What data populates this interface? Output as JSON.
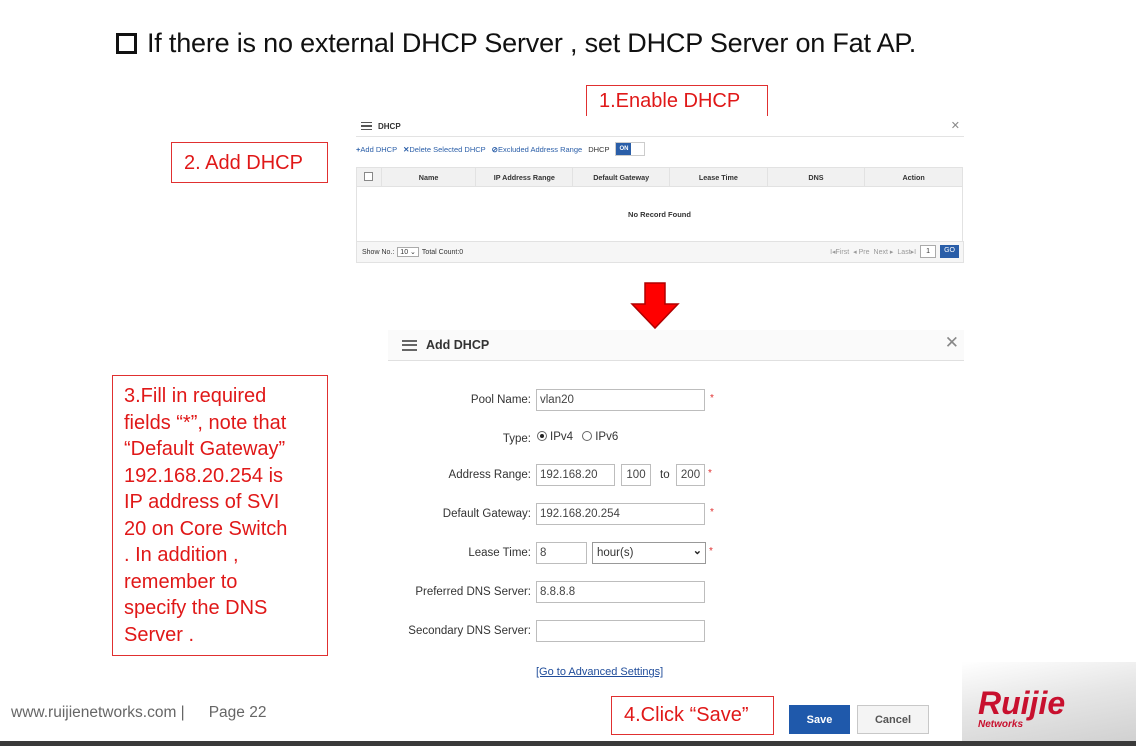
{
  "slide": {
    "title": "If there is no external DHCP Server , set DHCP Server on Fat AP.",
    "footer_url": "www.ruijienetworks.com |",
    "footer_page": "Page  22",
    "logo_text": "Ruijie",
    "logo_subtext": "Networks"
  },
  "callouts": {
    "enable_dhcp": "1.Enable DHCP",
    "add_dhcp": "2. Add DHCP",
    "click_save": "4.Click “Save”",
    "fill_fields_lines": [
      "3.Fill in required",
      "fields “*”,  note that",
      "“Default Gateway”",
      "192.168.20.254 is",
      "IP address of SVI",
      "20 on Core Switch",
      ". In addition ,",
      "remember to",
      "specify the DNS",
      "Server ."
    ]
  },
  "dhcp_window": {
    "title": "DHCP",
    "toolbar": {
      "add": "Add DHCP",
      "delete": "Delete Selected DHCP",
      "excluded": "Excluded Address Range",
      "dhcp_label": "DHCP",
      "toggle": "ON"
    },
    "columns": [
      "Name",
      "IP Address Range",
      "Default Gateway",
      "Lease Time",
      "DNS",
      "Action"
    ],
    "empty_text": "No Record Found",
    "footer": {
      "show_no": "Show No.:",
      "page_size": "10",
      "total": "Total Count:0",
      "first": "First",
      "pre": "Pre",
      "next": "Next",
      "last": "Last",
      "page": "1",
      "go": "GO"
    }
  },
  "add_dialog": {
    "title": "Add DHCP",
    "labels": {
      "pool_name": "Pool Name:",
      "type": "Type:",
      "address_range": "Address Range:",
      "default_gateway": "Default Gateway:",
      "lease_time": "Lease Time:",
      "preferred_dns": "Preferred DNS Server:",
      "secondary_dns": "Secondary DNS Server:"
    },
    "values": {
      "pool_name": "vlan20",
      "type_ipv4": "IPv4",
      "type_ipv6": "IPv6",
      "range_prefix": "192.168.20",
      "range_start": "100",
      "range_to": "to",
      "range_end": "200",
      "default_gateway": "192.168.20.254",
      "lease_time": "8",
      "lease_unit": "hour(s)",
      "preferred_dns": "8.8.8.8",
      "secondary_dns": ""
    },
    "required_mark": "*",
    "advanced_link": "[Go to Advanced Settings]",
    "save": "Save",
    "cancel": "Cancel"
  },
  "colors": {
    "callout_red": "#e01818",
    "accent_blue": "#1f59ab",
    "arrow_red": "#ff0000"
  }
}
